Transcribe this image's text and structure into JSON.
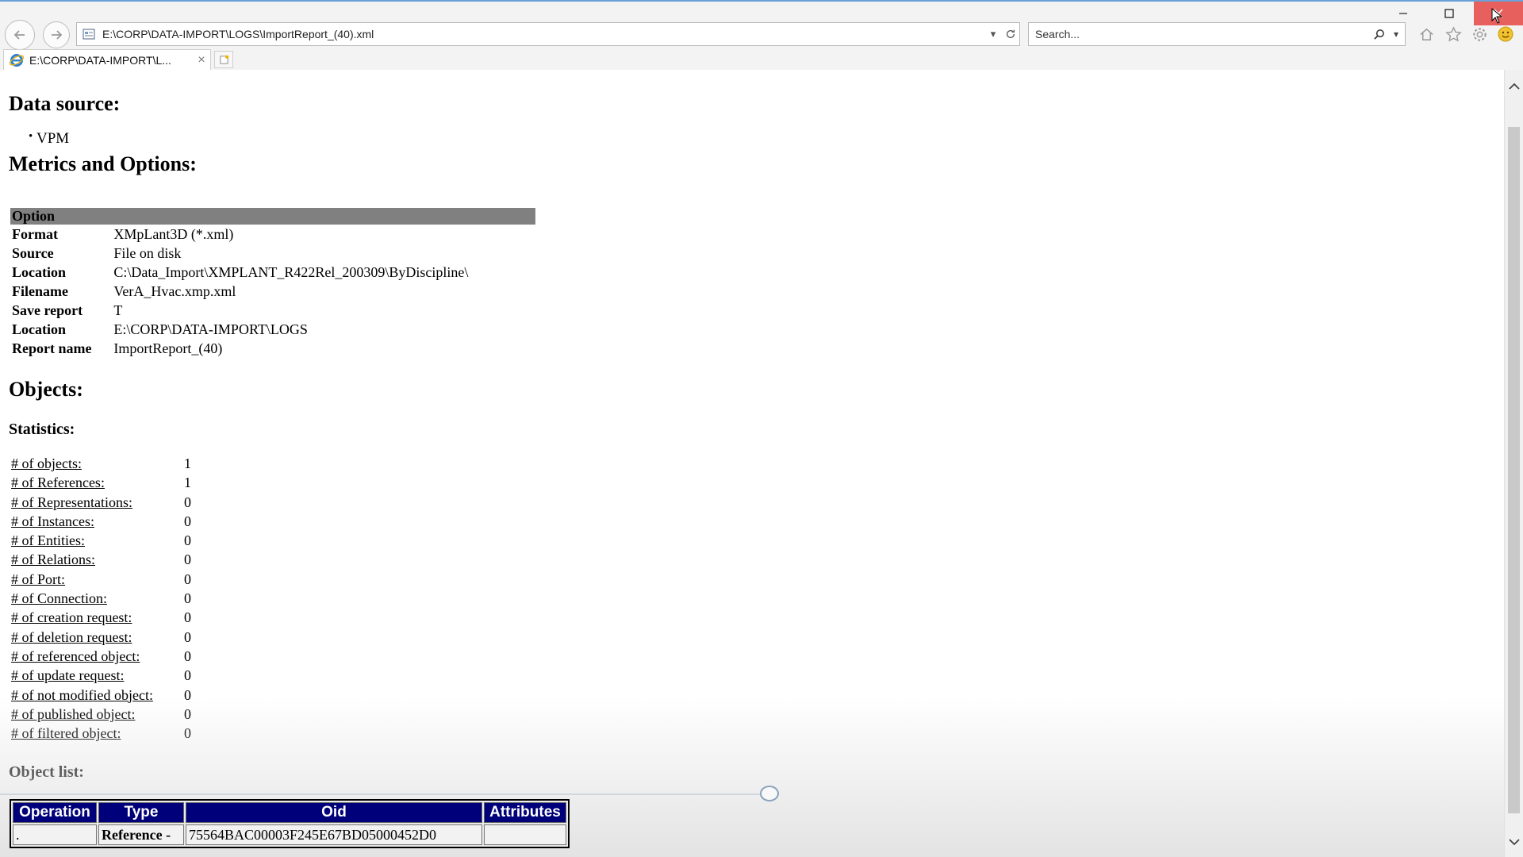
{
  "browser": {
    "address_url": "E:\\CORP\\DATA-IMPORT\\LOGS\\ImportReport_(40).xml",
    "search_placeholder": "Search...",
    "tab_title": "E:\\CORP\\DATA-IMPORT\\L...",
    "tab_close": "×",
    "icons": [
      "back-arrow-icon",
      "forward-arrow-icon",
      "page-icon",
      "dropdown-icon",
      "refresh-icon",
      "search-icon",
      "home-icon",
      "star-icon",
      "gear-icon",
      "smiley-icon",
      "ie-icon",
      "new-tab-icon",
      "minimize-icon",
      "maximize-icon",
      "close-icon"
    ]
  },
  "report": {
    "data_source_heading": "Data source:",
    "data_sources": [
      "VPM"
    ],
    "metrics_heading": "Metrics and Options:",
    "options_header": "Option",
    "options": [
      {
        "key": "Format",
        "value": "XMpLant3D (*.xml)"
      },
      {
        "key": "Source",
        "value": "File on disk"
      },
      {
        "key": "Location",
        "value": "C:\\Data_Import\\XMPLANT_R422Rel_200309\\ByDiscipline\\"
      },
      {
        "key": "Filename",
        "value": "VerA_Hvac.xmp.xml"
      },
      {
        "key": "Save report",
        "value": "T"
      },
      {
        "key": "Location",
        "value": "E:\\CORP\\DATA-IMPORT\\LOGS"
      },
      {
        "key": "Report name",
        "value": "ImportReport_(40)"
      }
    ],
    "objects_heading": "Objects:",
    "statistics_heading": "Statistics:",
    "statistics": [
      {
        "label": "# of objects:",
        "value": "1"
      },
      {
        "label": "# of References:",
        "value": "1"
      },
      {
        "label": "# of Representations:",
        "value": "0"
      },
      {
        "label": "# of Instances:",
        "value": "0"
      },
      {
        "label": "# of Entities:",
        "value": "0"
      },
      {
        "label": "# of Relations:",
        "value": "0"
      },
      {
        "label": "# of Port:",
        "value": "0"
      },
      {
        "label": "# of Connection:",
        "value": "0"
      },
      {
        "label": "# of creation request:",
        "value": "0"
      },
      {
        "label": "# of deletion request:",
        "value": "0"
      },
      {
        "label": "# of referenced object:",
        "value": "0"
      },
      {
        "label": "# of update request:",
        "value": "0"
      },
      {
        "label": "# of not modified object:",
        "value": "0"
      },
      {
        "label": "# of published object:",
        "value": "0"
      },
      {
        "label": "# of filtered object:",
        "value": "0"
      }
    ],
    "object_list_heading": "Object list:",
    "object_list_columns": [
      "Operation",
      "Type",
      "Oid",
      "Attributes"
    ],
    "object_list_rows": [
      {
        "operation": ".",
        "type": "Reference -",
        "oid": "75564BAC00003F245E67BD05000452D0",
        "attributes": ""
      }
    ]
  },
  "colors": {
    "option_header_bg": "#808080",
    "object_list_header_bg": "#00007a",
    "close_button": "#e8605e"
  }
}
